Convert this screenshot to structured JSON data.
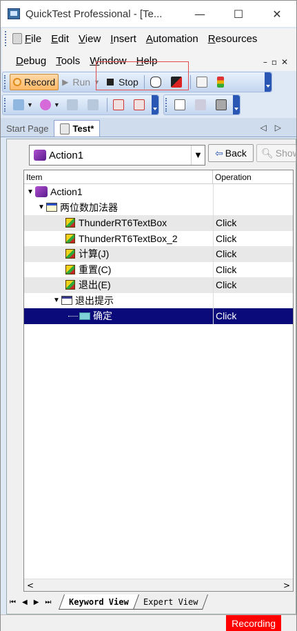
{
  "window": {
    "title": "QuickTest Professional - [Te...",
    "minimize_glyph": "—",
    "maximize_glyph": "☐",
    "close_glyph": "✕"
  },
  "menu": {
    "row1": [
      "File",
      "Edit",
      "View",
      "Insert",
      "Automation",
      "Resources"
    ],
    "row2": [
      "Debug",
      "Tools",
      "Window",
      "Help"
    ]
  },
  "toolbar": {
    "record_label": "Record",
    "run_label": "Run",
    "stop_label": "Stop"
  },
  "doc_tabs": {
    "start_page": "Start Page",
    "test": "Test*"
  },
  "action_combo": {
    "value": "Action1"
  },
  "buttons": {
    "back": "Back",
    "show": "Show"
  },
  "grid": {
    "headers": [
      "Item",
      "Operation"
    ],
    "rows": [
      {
        "item": "Action1",
        "operation": ""
      },
      {
        "item": "两位数加法器",
        "operation": ""
      },
      {
        "item": "ThunderRT6TextBox",
        "operation": "Click"
      },
      {
        "item": "ThunderRT6TextBox_2",
        "operation": "Click"
      },
      {
        "item": "计算(J)",
        "operation": "Click"
      },
      {
        "item": "重置(C)",
        "operation": "Click"
      },
      {
        "item": "退出(E)",
        "operation": "Click"
      },
      {
        "item": "退出提示",
        "operation": ""
      },
      {
        "item": "确定",
        "operation": "Click"
      }
    ]
  },
  "view_tabs": {
    "keyword": "Keyword View",
    "expert": "Expert View"
  },
  "status": {
    "recording": "Recording"
  },
  "colors": {
    "selection": "#0a0a7a",
    "recording": "#ff0000",
    "record_button": "#ffb866"
  }
}
